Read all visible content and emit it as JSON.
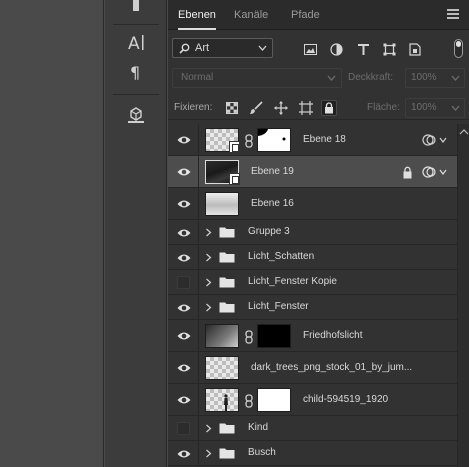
{
  "tabs": [
    {
      "label": "Ebenen",
      "active": true
    },
    {
      "label": "Kanäle",
      "active": false
    },
    {
      "label": "Pfade",
      "active": false
    }
  ],
  "filter": {
    "kind": "Art",
    "icons": [
      "pixel-filter-icon",
      "adjustment-filter-icon",
      "type-filter-icon",
      "shape-filter-icon",
      "smart-object-filter-icon"
    ]
  },
  "blend": {
    "mode": "Normal",
    "opacity_label": "Deckkraft:",
    "opacity_value": "100%"
  },
  "lock": {
    "label": "Fixieren:",
    "fill_label": "Fläche:",
    "fill_value": "100%"
  },
  "layers": [
    {
      "name": "Ebene 18",
      "type": "layer",
      "visible": true,
      "thumb": "checker",
      "has_mask": true,
      "mask": "white-black-spots",
      "smart_object": true,
      "fx": true,
      "locked": false,
      "selected": false
    },
    {
      "name": "Ebene 19",
      "type": "layer",
      "visible": true,
      "thumb": "dark-photo",
      "has_mask": false,
      "smart_object": true,
      "fx": true,
      "locked": true,
      "selected": true
    },
    {
      "name": "Ebene 16",
      "type": "layer",
      "visible": true,
      "thumb": "cloud",
      "has_mask": false,
      "smart_object": false,
      "fx": false,
      "locked": false,
      "selected": false
    },
    {
      "name": "Gruppe 3",
      "type": "group",
      "visible": true
    },
    {
      "name": "Licht_Schatten",
      "type": "group",
      "visible": true
    },
    {
      "name": "Licht_Fenster Kopie",
      "type": "group",
      "visible": false
    },
    {
      "name": "Licht_Fenster",
      "type": "group",
      "visible": true
    },
    {
      "name": "Friedhofslicht",
      "type": "layer",
      "visible": true,
      "thumb": "gradient",
      "has_mask": true,
      "mask": "black",
      "smart_object": false,
      "fx": false,
      "locked": false,
      "selected": false
    },
    {
      "name": "dark_trees_png_stock_01_by_jum...",
      "type": "layer",
      "visible": true,
      "thumb": "checker",
      "has_mask": false,
      "smart_object": false,
      "fx": false,
      "locked": false,
      "selected": false
    },
    {
      "name": "child-594519_1920",
      "type": "layer",
      "visible": true,
      "thumb": "checker-figure",
      "has_mask": true,
      "mask": "white",
      "smart_object": false,
      "fx": false,
      "locked": false,
      "selected": false
    },
    {
      "name": "Kind",
      "type": "group",
      "visible": false
    },
    {
      "name": "Busch",
      "type": "group",
      "visible": true
    }
  ],
  "colors": {
    "panel_bg": "#323232",
    "selected_row": "#4d4d4d",
    "tab_bar": "#2b2b2b",
    "canvas": "#4a4a4a"
  }
}
